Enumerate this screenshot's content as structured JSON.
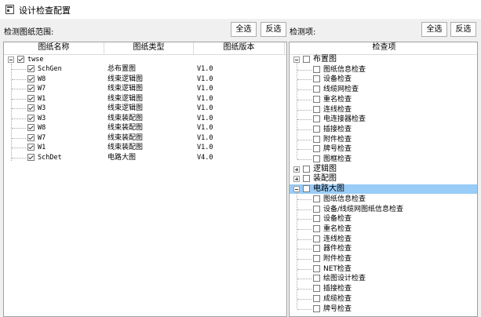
{
  "window": {
    "title": "设计检查配置"
  },
  "left": {
    "label": "检测图纸范围:",
    "select_all": "全选",
    "invert": "反选",
    "columns": [
      "图纸名称",
      "图纸类型",
      "图纸版本"
    ],
    "root": "twse",
    "rows": [
      {
        "name": "SchGen",
        "type": "总布置图",
        "version": "V1.0"
      },
      {
        "name": "W8",
        "type": "线束逻辑图",
        "version": "V1.0"
      },
      {
        "name": "W7",
        "type": "线束逻辑图",
        "version": "V1.0"
      },
      {
        "name": "W1",
        "type": "线束逻辑图",
        "version": "V1.0"
      },
      {
        "name": "W3",
        "type": "线束逻辑图",
        "version": "V1.0"
      },
      {
        "name": "W3",
        "type": "线束装配图",
        "version": "V1.0"
      },
      {
        "name": "W8",
        "type": "线束装配图",
        "version": "V1.0"
      },
      {
        "name": "W7",
        "type": "线束装配图",
        "version": "V1.0"
      },
      {
        "name": "W1",
        "type": "线束装配图",
        "version": "V1.0"
      },
      {
        "name": "SchDet",
        "type": "电路大图",
        "version": "V4.0"
      }
    ]
  },
  "right": {
    "label": "检测项:",
    "select_all": "全选",
    "invert": "反选",
    "column": "检查项",
    "groups": [
      {
        "name": "布置图",
        "expanded": true,
        "items": [
          "图纸信息检查",
          "设备检查",
          "线缆网检查",
          "重名检查",
          "连线检查",
          "电连接器检查",
          "插接检查",
          "附件检查",
          "牌号检查",
          "图框检查"
        ]
      },
      {
        "name": "逻辑图",
        "expanded": false,
        "items": []
      },
      {
        "name": "装配图",
        "expanded": false,
        "items": []
      },
      {
        "name": "电路大图",
        "expanded": true,
        "selected": true,
        "items": [
          "图纸信息检查",
          "设备/线缆网图纸信息检查",
          "设备检查",
          "重名检查",
          "连线检查",
          "器件检查",
          "附件检查",
          "NET检查",
          "绘图设计检查",
          "插接检查",
          "成缆检查",
          "牌号检查"
        ]
      }
    ]
  }
}
